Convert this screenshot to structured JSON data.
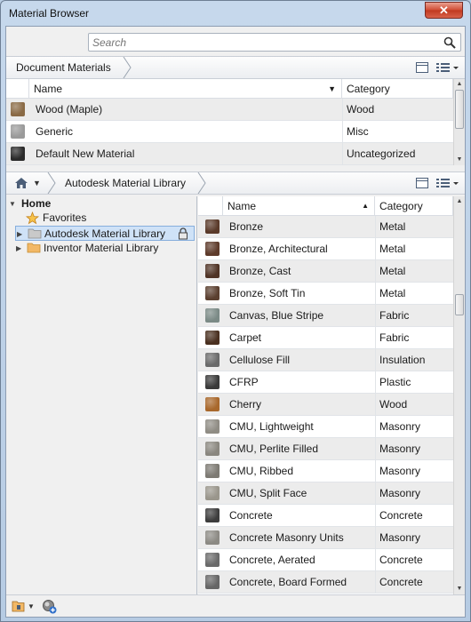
{
  "window": {
    "title": "Material Browser",
    "close_label": "✕"
  },
  "search": {
    "placeholder": "Search",
    "value": ""
  },
  "document_materials": {
    "crumb": "Document Materials",
    "columns": {
      "name": "Name",
      "category": "Category"
    },
    "rows": [
      {
        "name": "Wood (Maple)",
        "category": "Wood",
        "swatch": "#8a6a45"
      },
      {
        "name": "Generic",
        "category": "Misc",
        "swatch": "#9a9a9a"
      },
      {
        "name": "Default New Material",
        "category": "Uncategorized",
        "swatch": "#2a2a2a"
      }
    ]
  },
  "library_bar": {
    "crumb": "Autodesk Material Library"
  },
  "tree": {
    "home": "Home",
    "favorites": "Favorites",
    "autodesk": "Autodesk Material Library",
    "inventor": "Inventor Material Library"
  },
  "library": {
    "columns": {
      "name": "Name",
      "category": "Category"
    },
    "rows": [
      {
        "name": "Bronze",
        "category": "Metal",
        "swatch": "#5a3a2a"
      },
      {
        "name": "Bronze, Architectural",
        "category": "Metal",
        "swatch": "#5e3b2b"
      },
      {
        "name": "Bronze, Cast",
        "category": "Metal",
        "swatch": "#4f3325"
      },
      {
        "name": "Bronze, Soft Tin",
        "category": "Metal",
        "swatch": "#5b4030"
      },
      {
        "name": "Canvas, Blue Stripe",
        "category": "Fabric",
        "swatch": "#7b8a86"
      },
      {
        "name": "Carpet",
        "category": "Fabric",
        "swatch": "#4a3020"
      },
      {
        "name": "Cellulose Fill",
        "category": "Insulation",
        "swatch": "#6a6a6a"
      },
      {
        "name": "CFRP",
        "category": "Plastic",
        "swatch": "#3a3a3a"
      },
      {
        "name": "Cherry",
        "category": "Wood",
        "swatch": "#a8682c"
      },
      {
        "name": "CMU, Lightweight",
        "category": "Masonry",
        "swatch": "#8f8c84"
      },
      {
        "name": "CMU, Perlite Filled",
        "category": "Masonry",
        "swatch": "#8a877f"
      },
      {
        "name": "CMU, Ribbed",
        "category": "Masonry",
        "swatch": "#7d7a73"
      },
      {
        "name": "CMU, Split Face",
        "category": "Masonry",
        "swatch": "#9a968c"
      },
      {
        "name": "Concrete",
        "category": "Concrete",
        "swatch": "#3d3d3d"
      },
      {
        "name": "Concrete Masonry Units",
        "category": "Masonry",
        "swatch": "#8c8a84"
      },
      {
        "name": "Concrete, Aerated",
        "category": "Concrete",
        "swatch": "#6a6a6a"
      },
      {
        "name": "Concrete, Board Formed",
        "category": "Concrete",
        "swatch": "#666666"
      }
    ]
  }
}
